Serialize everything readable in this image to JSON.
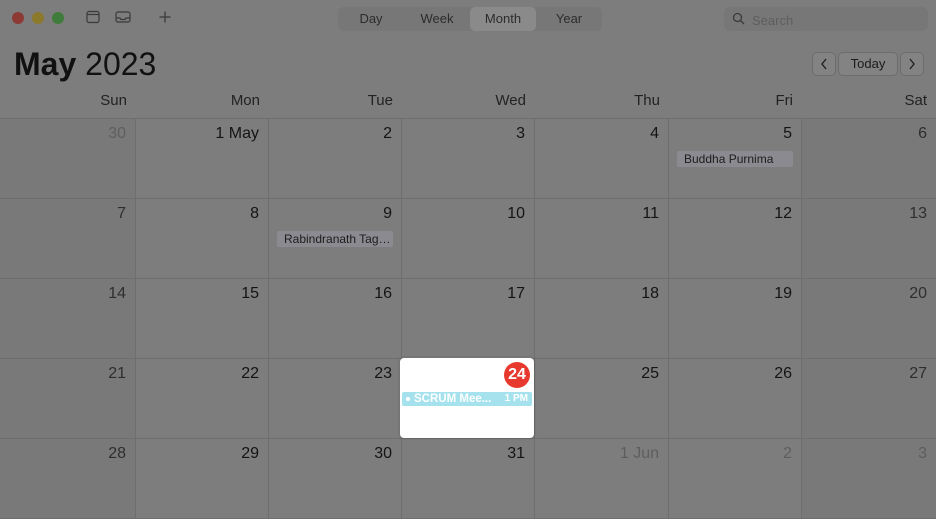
{
  "toolbar": {
    "views": [
      {
        "label": "Day",
        "active": false
      },
      {
        "label": "Week",
        "active": false
      },
      {
        "label": "Month",
        "active": true
      },
      {
        "label": "Year",
        "active": false
      }
    ],
    "search": {
      "placeholder": "Search",
      "value": ""
    }
  },
  "header": {
    "month": "May",
    "year": "2023",
    "today_label": "Today"
  },
  "weekdays": [
    "Sun",
    "Mon",
    "Tue",
    "Wed",
    "Thu",
    "Fri",
    "Sat"
  ],
  "weeks": [
    [
      {
        "day": "30",
        "outside": true
      },
      {
        "day": "1 May"
      },
      {
        "day": "2"
      },
      {
        "day": "3"
      },
      {
        "day": "4"
      },
      {
        "day": "5",
        "event": "Buddha Purnima"
      },
      {
        "day": "6"
      }
    ],
    [
      {
        "day": "7"
      },
      {
        "day": "8"
      },
      {
        "day": "9",
        "event": "Rabindranath Tagore Jayanti"
      },
      {
        "day": "10"
      },
      {
        "day": "11"
      },
      {
        "day": "12"
      },
      {
        "day": "13"
      }
    ],
    [
      {
        "day": "14"
      },
      {
        "day": "15"
      },
      {
        "day": "16"
      },
      {
        "day": "17"
      },
      {
        "day": "18"
      },
      {
        "day": "19"
      },
      {
        "day": "20"
      }
    ],
    [
      {
        "day": "21"
      },
      {
        "day": "22"
      },
      {
        "day": "23"
      },
      {
        "day": "24",
        "today": true
      },
      {
        "day": "25"
      },
      {
        "day": "26"
      },
      {
        "day": "27"
      }
    ],
    [
      {
        "day": "28"
      },
      {
        "day": "29"
      },
      {
        "day": "30"
      },
      {
        "day": "31"
      },
      {
        "day": "1 Jun",
        "outside": true
      },
      {
        "day": "2",
        "outside": true
      },
      {
        "day": "3",
        "outside": true
      }
    ]
  ],
  "today_cell": {
    "day": "24",
    "event_title": "SCRUM Mee...",
    "event_time": "1 PM"
  },
  "colors": {
    "today_badge": "#e8392e",
    "event_scrum": "#a5e2ed",
    "event_holiday": "#8a8a90"
  }
}
